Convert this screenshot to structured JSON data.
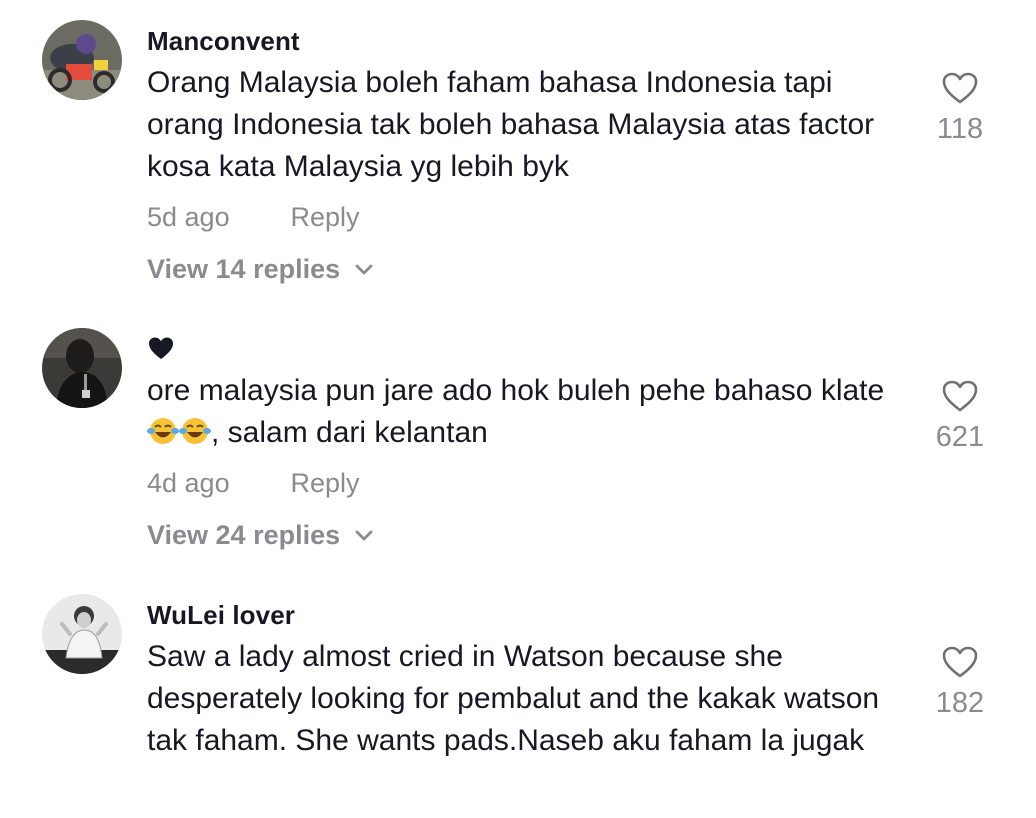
{
  "comments": [
    {
      "username": "Manconvent",
      "text": "Orang Malaysia boleh faham bahasa Indonesia tapi orang Indonesia tak boleh bahasa Malaysia atas factor kosa kata Malaysia yg lebih byk",
      "time": "5d ago",
      "reply_label": "Reply",
      "view_replies": "View 14 replies",
      "likes": "118"
    },
    {
      "username_icon": "black-heart",
      "text_before_emoji": "ore malaysia pun jare ado hok buleh pehe bahaso klate",
      "text_after_emoji": ", salam dari kelantan",
      "emoji": [
        "face-with-tears-of-joy",
        "face-with-tears-of-joy"
      ],
      "time": "4d ago",
      "reply_label": "Reply",
      "view_replies": "View 24 replies",
      "likes": "621"
    },
    {
      "username": "WuLei lover",
      "text": "Saw a lady almost cried in Watson because she desperately looking for pembalut and the kakak watson tak faham. She wants pads.Naseb aku faham la jugak",
      "likes": "182"
    }
  ],
  "colors": {
    "text": "#161823",
    "secondary": "#8a8b91"
  }
}
